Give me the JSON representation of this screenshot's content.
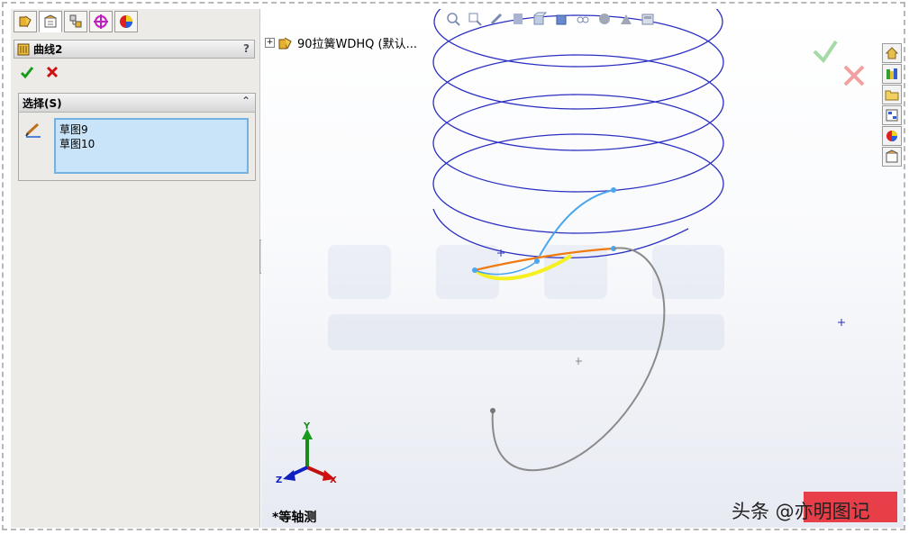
{
  "property_manager": {
    "title": "曲线2",
    "help": "?",
    "tabs": [
      "feature-manager-icon",
      "property-manager-icon",
      "configuration-manager-icon",
      "dimxpert-icon",
      "display-manager-icon"
    ],
    "selection": {
      "title": "选择(S)",
      "collapse": "⌃",
      "items": [
        "草图9",
        "草图10"
      ]
    }
  },
  "feature_tree": {
    "root_expander": "+",
    "root_label": "90拉簧WDHQ (默认..."
  },
  "viewport": {
    "view_name": "*等轴测",
    "triad_labels": {
      "x": "X",
      "y": "Y",
      "z": "Z"
    }
  },
  "watermark": {
    "text": "头条 @亦明图记"
  },
  "colors": {
    "helix": "#2a2fc0",
    "sketch9": "#f07a10",
    "sketch10": "#4aa6ee",
    "selection_yellow": "#f5f020",
    "gray_curve": "#8a8a8a",
    "selection_bg": "#c9e4f8"
  }
}
